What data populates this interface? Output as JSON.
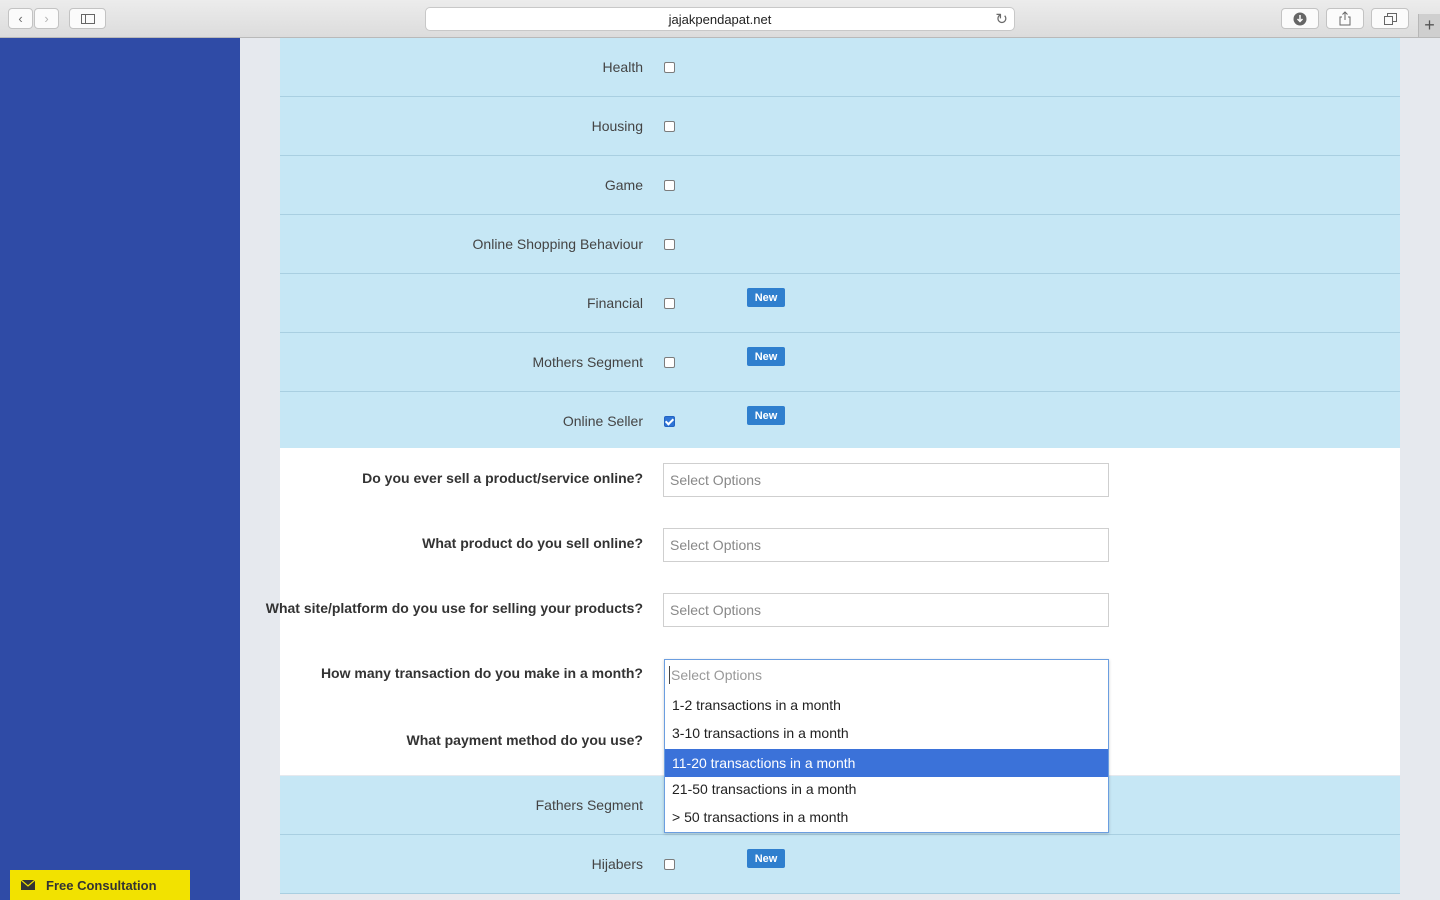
{
  "browser": {
    "url": "jajakpendapat.net"
  },
  "categories": [
    {
      "label": "Health",
      "checked": false,
      "badge": ""
    },
    {
      "label": "Housing",
      "checked": false,
      "badge": ""
    },
    {
      "label": "Game",
      "checked": false,
      "badge": ""
    },
    {
      "label": "Online Shopping Behaviour",
      "checked": false,
      "badge": ""
    },
    {
      "label": "Financial",
      "checked": false,
      "badge": "New"
    },
    {
      "label": "Mothers Segment",
      "checked": false,
      "badge": "New"
    },
    {
      "label": "Online Seller",
      "checked": true,
      "badge": "New"
    }
  ],
  "questions": [
    {
      "label": "Do you ever sell a product/service online?",
      "placeholder": "Select Options"
    },
    {
      "label": "What product do you sell online?",
      "placeholder": "Select Options"
    },
    {
      "label": "What site/platform do you use for selling your products?",
      "placeholder": "Select Options"
    },
    {
      "label": "How many transaction do you make in a month?",
      "placeholder": "Select Options"
    },
    {
      "label": "What payment method do you use?",
      "placeholder": ""
    }
  ],
  "dropdown": {
    "placeholder": "Select Options",
    "options": [
      "1-2 transactions in a month",
      "3-10 transactions in a month",
      "11-20 transactions in a month",
      "21-50 transactions in a month",
      "> 50 transactions in a month"
    ],
    "highlighted": "11-20 transactions in a month"
  },
  "more_categories": [
    {
      "label": "Fathers Segment",
      "checked": false,
      "badge": ""
    },
    {
      "label": "Hijabers",
      "checked": false,
      "badge": "New"
    }
  ],
  "consultation": {
    "label": "Free Consultation"
  },
  "colors": {
    "sidebar": "#2f4ba6",
    "row_bg": "#c6e7f5",
    "badge": "#2f7fce",
    "highlight": "#3b72d9",
    "consult": "#f2e200"
  }
}
